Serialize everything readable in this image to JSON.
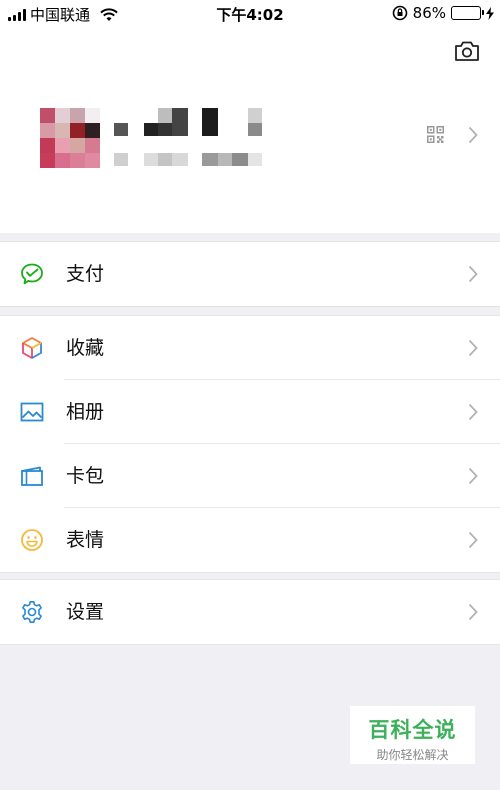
{
  "status_bar": {
    "carrier": "中国联通",
    "time": "下午4:02",
    "battery_percent": "86%",
    "battery_level": 0.86,
    "battery_color": "#2ec05b"
  },
  "profile": {
    "camera_icon": "camera-icon",
    "qr_icon": "qr-code-icon",
    "chevron_icon": "chevron-right-icon"
  },
  "menu": {
    "pay": {
      "label": "支付",
      "icon": "wallet-check-icon",
      "icon_color": "#1aad19"
    },
    "favorites": {
      "label": "收藏",
      "icon": "cube-icon"
    },
    "album": {
      "label": "相册",
      "icon": "picture-icon",
      "icon_color": "#2a8ad0"
    },
    "cards": {
      "label": "卡包",
      "icon": "card-wallet-icon",
      "icon_color": "#2a8ad0"
    },
    "stickers": {
      "label": "表情",
      "icon": "smiley-icon",
      "icon_color": "#f5b93a"
    },
    "settings": {
      "label": "设置",
      "icon": "gear-icon",
      "icon_color": "#2a8ad0"
    }
  },
  "watermark": {
    "title": "百科全说",
    "subtitle": "助你轻松解决",
    "color": "#3cb15a"
  }
}
